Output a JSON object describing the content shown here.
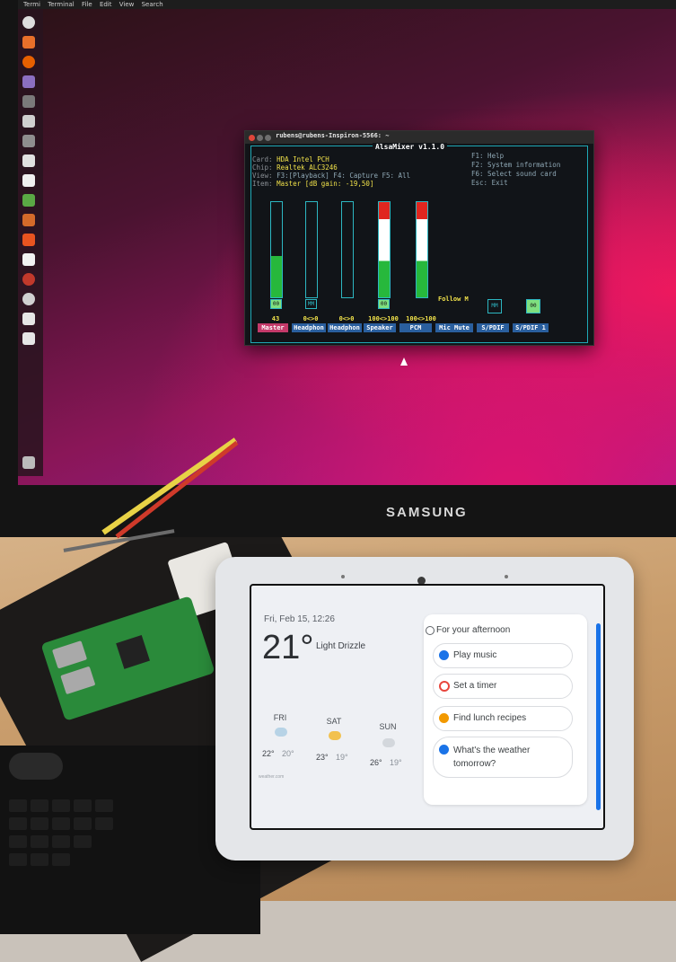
{
  "colors": {
    "terminal_accent": "#1fa9b6",
    "alsa_yellow": "#f0e14a",
    "bar_green": "#27b83c",
    "bar_red": "#e0261f",
    "nest_blue": "#1a73e8"
  },
  "monitor": {
    "brand": "SAMSUNG",
    "menubar": [
      "Termi",
      "Terminal",
      "File",
      "Edit",
      "View",
      "Search"
    ],
    "terminal": {
      "title": "rubens@rubens-Inspiron-5566: ~",
      "app_title": "AlsaMixer v1.1.0",
      "info": [
        {
          "label": "Card:",
          "value": "HDA Intel PCH"
        },
        {
          "label": "Chip:",
          "value": "Realtek ALC3246"
        },
        {
          "label": "View:",
          "value": "F3:[Playback] F4: Capture  F5: All"
        },
        {
          "label": "Item:",
          "value": "Master [dB gain: -19,50]"
        }
      ],
      "keys": [
        "F1:  Help",
        "F2:  System information",
        "F6:  Select sound card",
        "Esc: Exit"
      ],
      "follow_label": "Follow M",
      "channels": [
        {
          "name": "Master",
          "value": "43",
          "level": 0.43,
          "mute": "00",
          "selected": true
        },
        {
          "name": "Headphon",
          "value": "0<>0",
          "level": 0,
          "mute": "MM",
          "selected": false
        },
        {
          "name": "Headphon",
          "value": "0<>0",
          "level": 0,
          "mute": "",
          "selected": false
        },
        {
          "name": "Speaker",
          "value": "100<>100",
          "level": 1.0,
          "mute": "00",
          "selected": false
        },
        {
          "name": "PCM",
          "value": "100<>100",
          "level": 1.0,
          "mute": "",
          "selected": false
        },
        {
          "name": "Mic Mute",
          "value": "",
          "level": null,
          "mute": "MM",
          "selected": false
        },
        {
          "name": "S/PDIF",
          "value": "",
          "level": null,
          "mute": "00",
          "selected": false
        },
        {
          "name": "S/PDIF 1",
          "value": "",
          "level": null,
          "mute": "",
          "selected": false
        }
      ]
    }
  },
  "nest_hub": {
    "datetime": "Fri, Feb 15, 12:26",
    "temperature": "21°",
    "condition": "Light Drizzle",
    "forecast": [
      {
        "day": "FRI",
        "hi": "22°",
        "lo": "20°",
        "icon": "drizzle-icon"
      },
      {
        "day": "SAT",
        "hi": "23°",
        "lo": "19°",
        "icon": "partly-sunny-icon"
      },
      {
        "day": "SUN",
        "hi": "26°",
        "lo": "19°",
        "icon": "cloud-icon"
      }
    ],
    "footer": "weather.com",
    "card": {
      "heading": "For your afternoon",
      "suggestions": [
        {
          "label": "Play music",
          "icon": "music-icon",
          "color": "#1a73e8"
        },
        {
          "label": "Set a timer",
          "icon": "timer-icon",
          "color": "#e8453c"
        },
        {
          "label": "Find lunch recipes",
          "icon": "recipe-icon",
          "color": "#f29900"
        },
        {
          "label": "What's the weather tomorrow?",
          "icon": "weather-icon",
          "color": "#1a73e8"
        }
      ]
    }
  }
}
